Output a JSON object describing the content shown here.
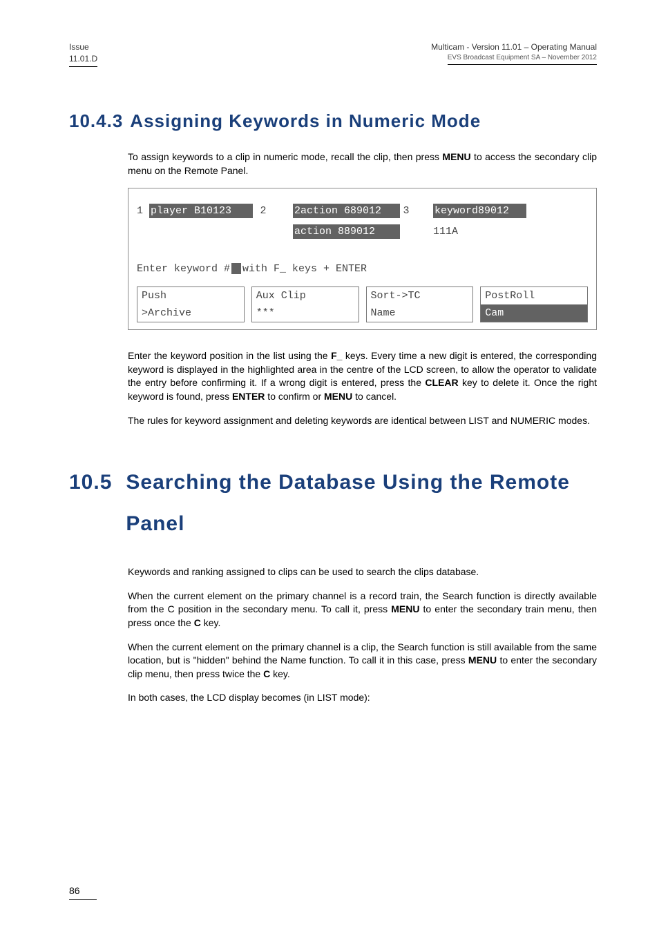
{
  "header": {
    "left_line1": "Issue",
    "left_line2": "11.01.D",
    "right_line1": "Multicam - Version 11.01 – Operating Manual",
    "right_line2": "EVS Broadcast Equipment SA – November 2012"
  },
  "h3": {
    "number": "10.4.3",
    "title": "Assigning Keywords in Numeric Mode"
  },
  "p1_pre": "To assign keywords to a clip in numeric mode, recall the clip, then press ",
  "p1_bold": "MENU",
  "p1_post": " to access the secondary clip menu on the Remote Panel.",
  "lcd": {
    "row1": {
      "n1": "1",
      "seg1": "player B10123",
      "n2": "2",
      "seg2": "2action 689012",
      "n3": "3",
      "seg3": "keyword89012"
    },
    "row2": {
      "mid": "action 889012",
      "right": "111A"
    },
    "prompt_pre": "Enter keyword #",
    "prompt_post": " with F_ keys + ENTER",
    "btns": [
      {
        "top": "Push",
        "bot": ">Archive",
        "inv": false
      },
      {
        "top": "Aux Clip",
        "bot": "***",
        "inv": false
      },
      {
        "top": "Sort->TC",
        "bot": "Name",
        "inv": false
      },
      {
        "top": "PostRoll",
        "bot": "Cam",
        "inv": true
      }
    ]
  },
  "p2_parts": [
    "Enter the keyword position in the list using the ",
    "F_",
    " keys. Every time a new digit is entered, the corresponding keyword is displayed in the highlighted area in the centre of the LCD screen, to allow the operator to validate the entry before confirming it. If a wrong digit is entered, press the ",
    "CLEAR",
    " key to delete it. Once the right keyword is found, press ",
    "ENTER",
    " to confirm or ",
    "MENU",
    " to cancel."
  ],
  "p3": "The rules for keyword assignment and deleting keywords are identical between LIST and NUMERIC modes.",
  "h2": {
    "number": "10.5",
    "title": "Searching the Database Using the Remote Panel"
  },
  "p4": "Keywords and ranking assigned to clips can be used to search the clips database.",
  "p5_parts": [
    "When the current element on the primary channel is a record train, the Search function is directly available from the C position in the secondary menu. To call it, press ",
    "MENU",
    " to enter the secondary train menu, then press once the ",
    "C",
    " key."
  ],
  "p6_parts": [
    "When the current element on the primary channel is a clip, the Search function is still available from the same location, but is \"hidden\" behind the Name function. To call it in this case, press ",
    "MENU",
    " to enter the secondary clip menu, then press twice the ",
    "C",
    " key."
  ],
  "p7": "In both cases, the LCD display becomes (in LIST mode):",
  "page_number": "86"
}
